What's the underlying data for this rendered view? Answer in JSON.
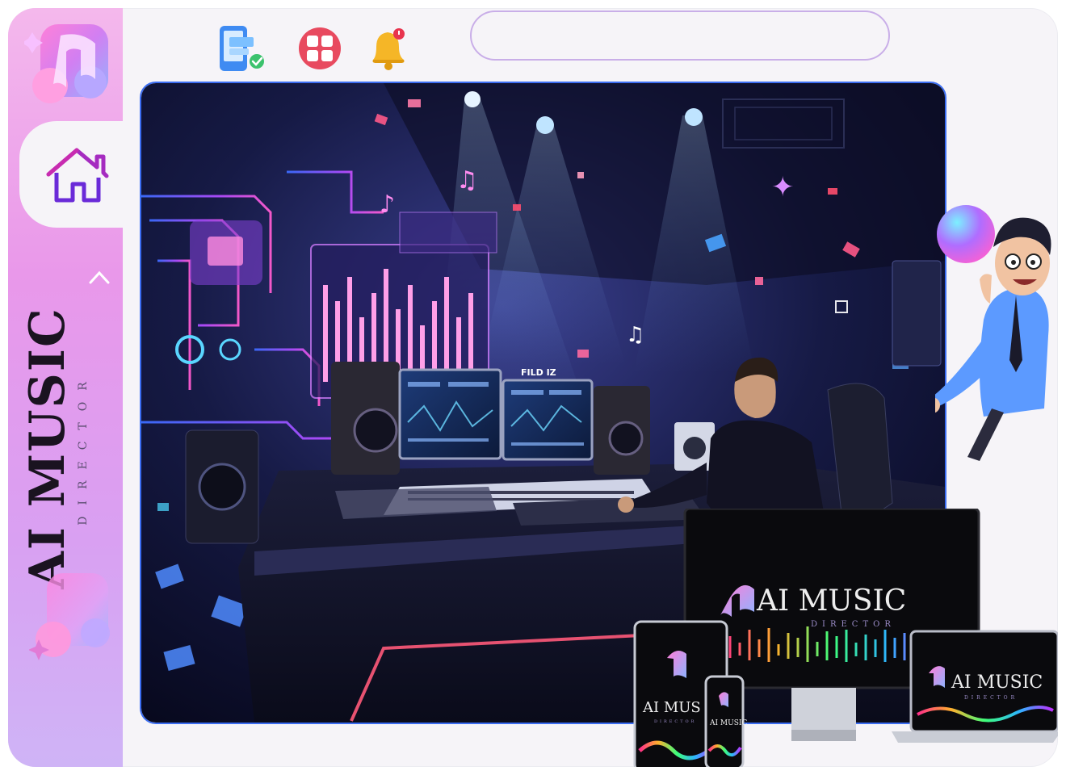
{
  "brand": {
    "name": "AI MUSIC",
    "tagline": "DIRECTOR"
  },
  "topbar": {
    "search_value": "",
    "search_placeholder": "",
    "icons": [
      "mobile-check-icon",
      "apps-grid-icon",
      "bell-notification-icon"
    ]
  },
  "sidebar": {
    "items": [
      {
        "icon": "home-icon"
      },
      {
        "icon": "chevron-up-icon"
      }
    ]
  },
  "hero": {
    "screen_sign": "FILD IZ"
  },
  "product": {
    "monitor_title": "AI MUSIC",
    "monitor_tagline": "DIRECTOR",
    "laptop_title": "AI MUSIC",
    "laptop_tagline": "DIRECTOR",
    "tablet_title": "AI MUS",
    "tablet_tagline": "DIRECTOR",
    "phone_title": "AI MUSIC"
  },
  "colors": {
    "accent": "#b46df0",
    "sidebar_pink": "#ee9fe9",
    "hero_border": "#3b6df2",
    "neon_cyan": "#4fd8ff",
    "neon_pink": "#ff5aa8"
  }
}
